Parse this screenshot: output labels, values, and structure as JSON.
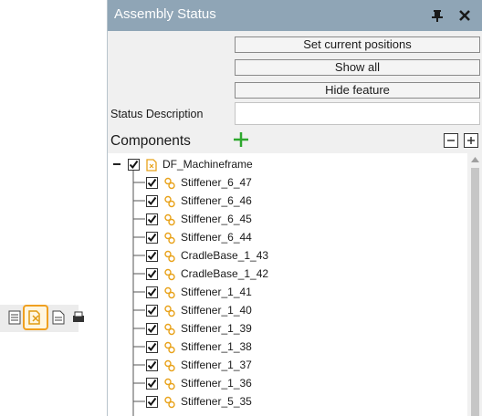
{
  "panel": {
    "title": "Assembly Status",
    "buttons": {
      "set_current_positions": "Set current positions",
      "show_all": "Show all",
      "hide_feature": "Hide feature"
    },
    "status_description": {
      "label": "Status Description",
      "value": ""
    },
    "components_label": "Components"
  },
  "tree": {
    "root": {
      "label": "DF_Machineframe",
      "checked": true,
      "expanded": true
    },
    "children": [
      {
        "label": "Stiffener_6_47",
        "checked": true
      },
      {
        "label": "Stiffener_6_46",
        "checked": true
      },
      {
        "label": "Stiffener_6_45",
        "checked": true
      },
      {
        "label": "Stiffener_6_44",
        "checked": true
      },
      {
        "label": "CradleBase_1_43",
        "checked": true
      },
      {
        "label": "CradleBase_1_42",
        "checked": true
      },
      {
        "label": "Stiffener_1_41",
        "checked": true
      },
      {
        "label": "Stiffener_1_40",
        "checked": true
      },
      {
        "label": "Stiffener_1_39",
        "checked": true
      },
      {
        "label": "Stiffener_1_38",
        "checked": true
      },
      {
        "label": "Stiffener_1_37",
        "checked": true
      },
      {
        "label": "Stiffener_1_36",
        "checked": true
      },
      {
        "label": "Stiffener_5_35",
        "checked": true
      }
    ]
  },
  "icons": {
    "assembly_icon": "assembly-folder-icon",
    "part_icon": "component-link-icon",
    "pin": "pin-icon",
    "close": "close-icon"
  },
  "colors": {
    "titlebar": "#8fa5b6",
    "accent_orange": "#f0a020",
    "add_green": "#2ea82e"
  }
}
